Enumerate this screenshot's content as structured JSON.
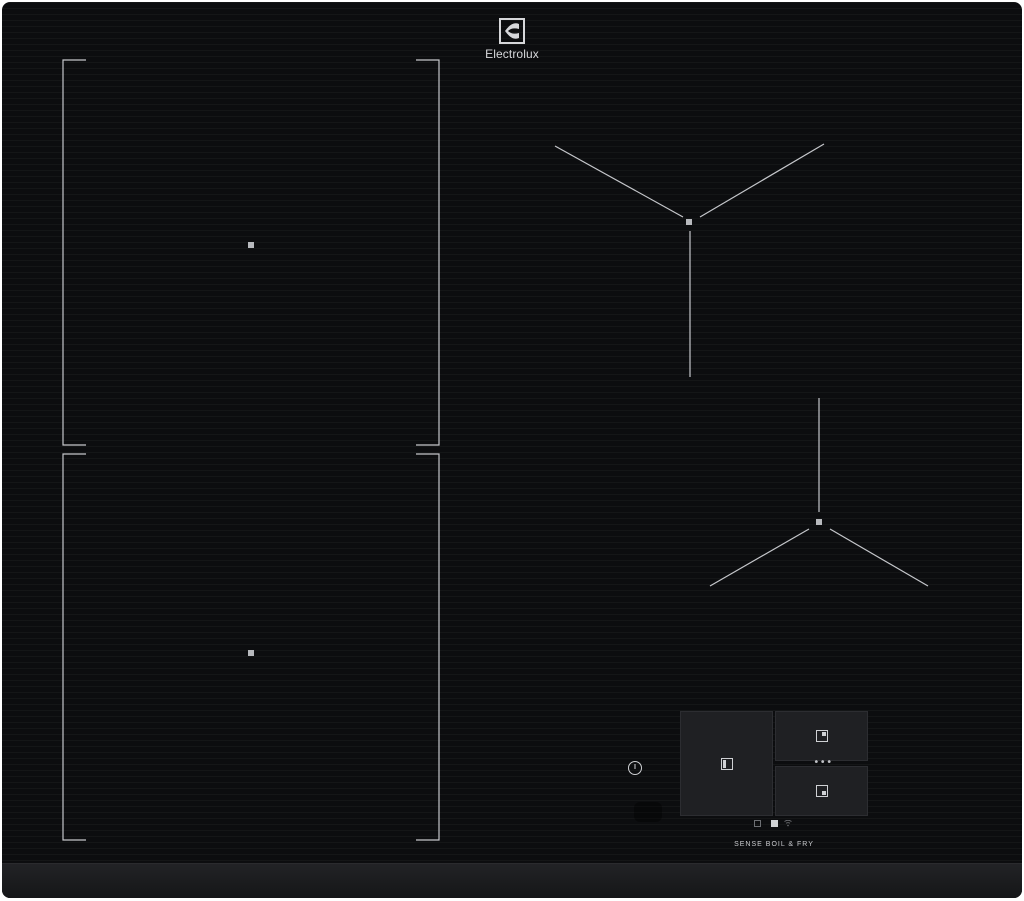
{
  "brand": {
    "name": "Electrolux",
    "logo_icon": "electrolux-logo-icon"
  },
  "cooking_zones": [
    {
      "name": "bridge-zone-front-left",
      "icon": "zone-center-marker"
    },
    {
      "name": "bridge-zone-rear-left",
      "icon": "zone-center-marker"
    },
    {
      "name": "rear-right-zone",
      "icon": "zone-center-marker"
    },
    {
      "name": "front-right-zone",
      "icon": "zone-center-marker"
    }
  ],
  "controls": {
    "power_icon": "power-icon",
    "keys": [
      {
        "name": "zone-select-left-key",
        "icon": "pan-left-icon"
      },
      {
        "name": "zone-select-top-right-key",
        "icon": "pan-top-right-icon"
      },
      {
        "name": "zone-select-bottom-right-key",
        "icon": "pan-bottom-right-icon"
      }
    ],
    "more_icon": "ellipsis-icon",
    "status_icons": [
      "square-outline-icon",
      "square-filled-icon",
      "wifi-icon"
    ],
    "sense_label": "SENSE BOIL & FRY"
  },
  "colors": {
    "glass": "#0c0d0f",
    "line": "#c5c7cb",
    "key_bg": "#1f2023",
    "text": "#d6d7da"
  }
}
